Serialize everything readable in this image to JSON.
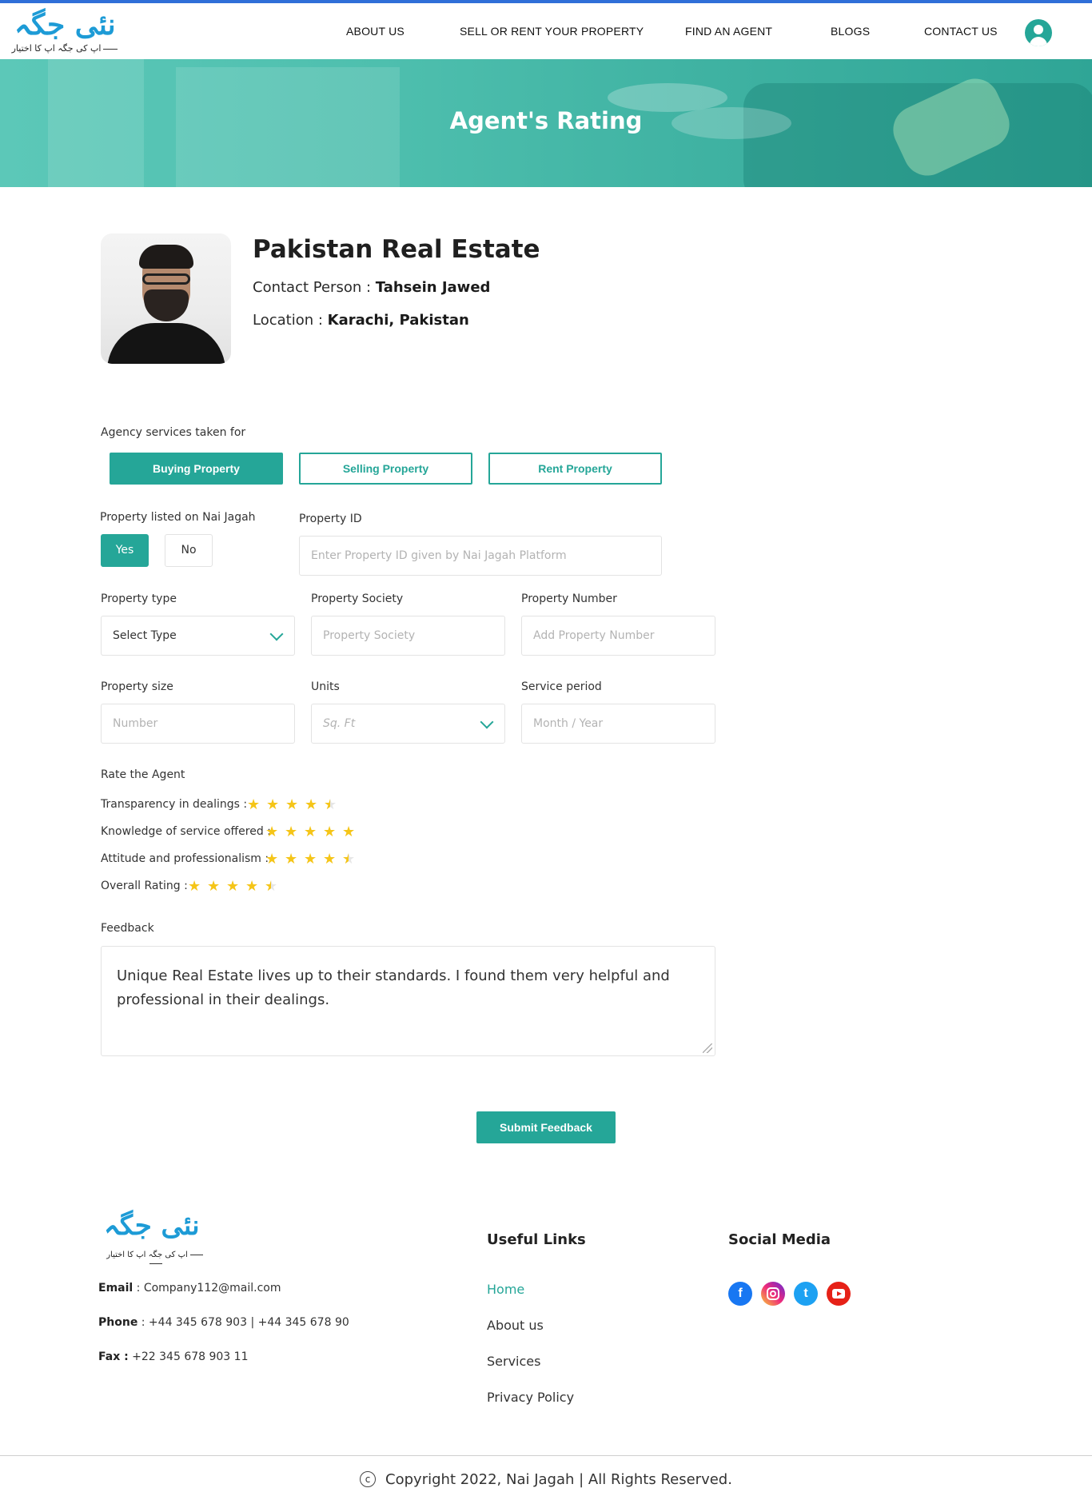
{
  "brand": {
    "logo_text": "نئی جگہ",
    "tagline": "اپ کی جگہ اپ کا اختیار",
    "accent_color": "#25a698",
    "logo_color": "#1d9bd6"
  },
  "nav": {
    "items": [
      "ABOUT US",
      "SELL OR RENT YOUR PROPERTY",
      "FIND AN AGENT",
      "BLOGS",
      "CONTACT US"
    ],
    "user_icon": "user-icon"
  },
  "hero": {
    "title": "Agent's Rating"
  },
  "agent": {
    "name": "Pakistan Real Estate",
    "contact_label": "Contact Person : ",
    "contact_value": "Tahsein Jawed",
    "location_label": "Location : ",
    "location_value": "Karachi, Pakistan"
  },
  "form": {
    "services_label": "Agency services taken for",
    "services": [
      {
        "label": "Buying Property",
        "selected": true
      },
      {
        "label": "Selling Property",
        "selected": false
      },
      {
        "label": "Rent Property",
        "selected": false
      }
    ],
    "listed_label": "Property listed on Nai Jagah",
    "yes_label": "Yes",
    "no_label": "No",
    "listed_value": "Yes",
    "property_id_label": "Property ID",
    "property_id_placeholder": "Enter Property ID given by Nai Jagah Platform",
    "property_type_label": "Property type",
    "property_type_value": "Select Type",
    "property_society_label": "Property Society",
    "property_society_placeholder": "Property Society",
    "property_number_label": "Property Number",
    "property_number_placeholder": "Add Property Number",
    "property_size_label": "Property size",
    "property_size_placeholder": "Number",
    "units_label": "Units",
    "units_placeholder": "Sq. Ft",
    "service_period_label": "Service period",
    "service_period_placeholder": "Month / Year",
    "rate_label": "Rate the Agent",
    "ratings": [
      {
        "label": "Transparency in dealings  :",
        "value": 4.5
      },
      {
        "label": "Knowledge of service offered :",
        "value": 5
      },
      {
        "label": "Attitude and professionalism :",
        "value": 4.5
      },
      {
        "label": "Overall Rating :",
        "value": 4.5
      }
    ],
    "feedback_label": "Feedback",
    "feedback_value": "Unique Real Estate lives up to their standards. I found them very helpful and professional in their dealings.",
    "submit_label": "Submit Feedback"
  },
  "footer": {
    "email_label": "Email",
    "email_value": " : Company112@mail.com",
    "phone_label": "Phone",
    "phone_value": " : +44 345 678 903   |  +44 345 678 90",
    "fax_label": "Fax :",
    "fax_value": " +22 345 678 903 11",
    "useful_links_title": "Useful Links",
    "links": [
      "Home",
      "About us",
      "Services",
      "Privacy Policy"
    ],
    "social_title": "Social Media",
    "social": [
      "facebook-icon",
      "instagram-icon",
      "twitter-icon",
      "youtube-icon"
    ],
    "copyright_symbol": "c",
    "copyright": "Copyright  2022, Nai Jagah |  All Rights Reserved."
  }
}
